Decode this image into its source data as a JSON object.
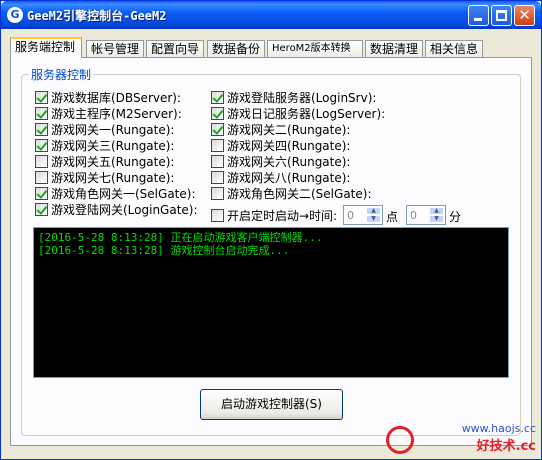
{
  "window": {
    "title": "GeeM2引擎控制台-GeeM2"
  },
  "tabs": [
    {
      "label": "服务端控制",
      "active": true
    },
    {
      "label": "帐号管理"
    },
    {
      "label": "配置向导"
    },
    {
      "label": "数据备份"
    },
    {
      "label": "HeroM2版本转换"
    },
    {
      "label": "数据清理"
    },
    {
      "label": "相关信息"
    }
  ],
  "group_title": "服务器控制",
  "left_checks": [
    {
      "label": "游戏数据库(DBServer):",
      "checked": true
    },
    {
      "label": "游戏主程序(M2Server):",
      "checked": true
    },
    {
      "label": "游戏网关一(Rungate):",
      "checked": true
    },
    {
      "label": "游戏网关三(Rungate):",
      "checked": true
    },
    {
      "label": "游戏网关五(Rungate):",
      "checked": false
    },
    {
      "label": "游戏网关七(Rungate):",
      "checked": false
    },
    {
      "label": "游戏角色网关一(SelGate):",
      "checked": true
    },
    {
      "label": "游戏登陆网关(LoginGate):",
      "checked": true
    }
  ],
  "right_checks": [
    {
      "label": "游戏登陆服务器(LoginSrv):",
      "checked": true
    },
    {
      "label": "游戏日记服务器(LogServer):",
      "checked": true
    },
    {
      "label": "游戏网关二(Rungate):",
      "checked": true
    },
    {
      "label": "游戏网关四(Rungate):",
      "checked": false
    },
    {
      "label": "游戏网关六(Rungate):",
      "checked": false
    },
    {
      "label": "游戏网关八(Rungate):",
      "checked": false
    },
    {
      "label": "游戏角色网关二(SelGate):",
      "checked": false
    }
  ],
  "timer": {
    "label": "开启定时启动→时间:",
    "checked": false,
    "hour": "0",
    "hour_unit": "点",
    "minute": "0",
    "minute_unit": "分"
  },
  "log_lines": [
    "[2016-5-28 8:13:28] 正在启动游戏客户端控制器...",
    "[2016-5-28 8:13:28] 游戏控制台启动完成..."
  ],
  "start_button": "启动游戏控制器(S)",
  "watermark": {
    "url": "www.haojs.cc",
    "text": "好技术.cc"
  },
  "colors": {
    "titlebar": "#0a5ef7",
    "group_label": "#0046d5",
    "log_text": "#00e000",
    "log_bg": "#000000"
  }
}
